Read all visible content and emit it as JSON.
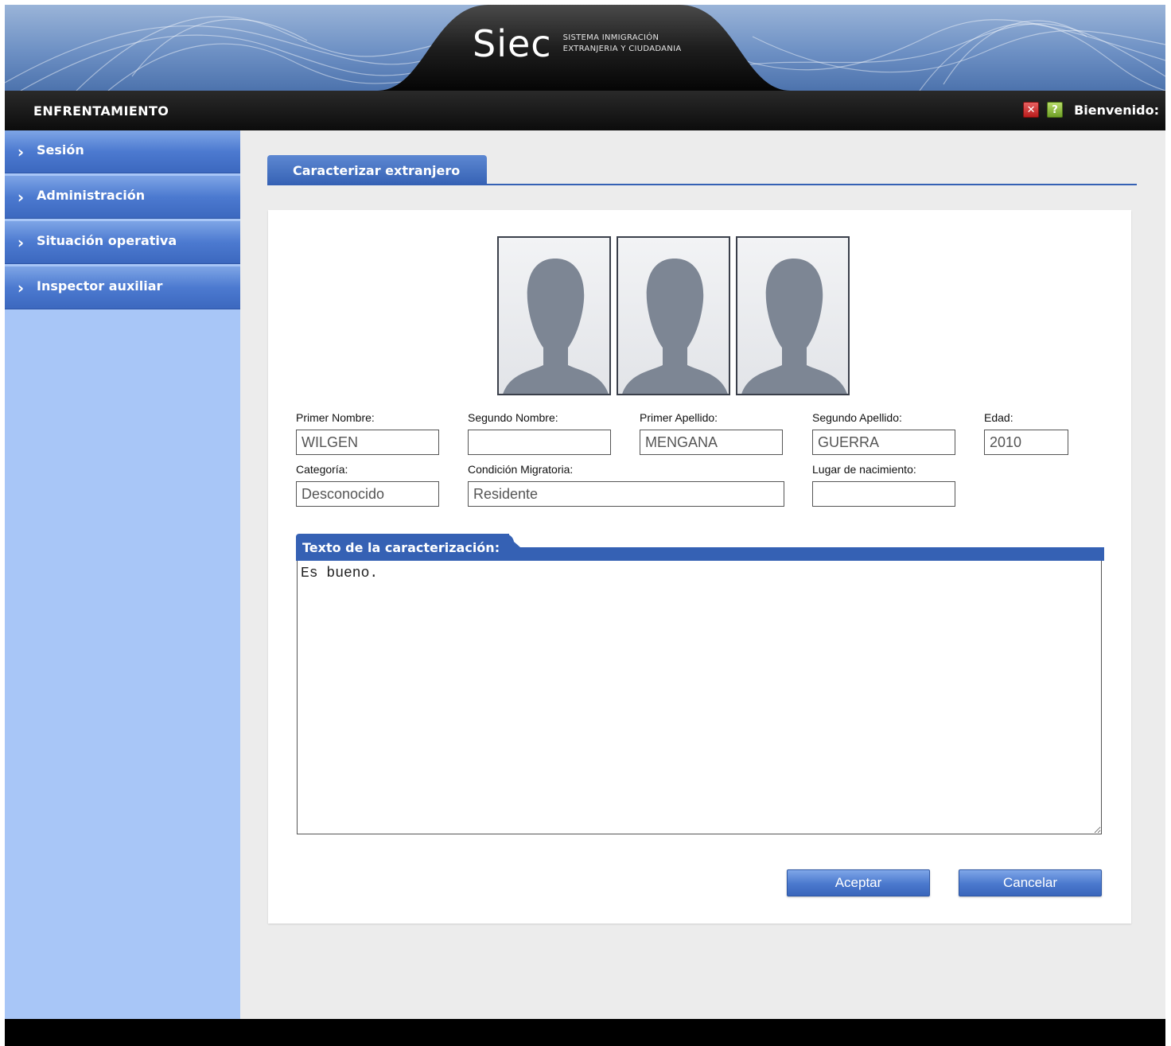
{
  "header": {
    "logo_text": "Siec",
    "logo_subtitle_line1": "SISTEMA INMIGRACIÓN",
    "logo_subtitle_line2": "EXTRANJERIA  Y CIUDADANIA",
    "section_title": "ENFRENTAMIENTO",
    "welcome": "Bienvenido:",
    "close_icon": "close-icon",
    "help_icon": "help-icon",
    "close_glyph": "✕",
    "help_glyph": "?"
  },
  "sidebar": {
    "items": [
      {
        "label": "Sesión",
        "icon": "chevron-right-icon"
      },
      {
        "label": "Administración",
        "icon": "chevron-right-icon"
      },
      {
        "label": "Situación operativa",
        "icon": "chevron-right-icon"
      },
      {
        "label": "Inspector auxiliar",
        "icon": "chevron-right-icon"
      }
    ]
  },
  "main": {
    "tab_label": "Caracterizar extranjero",
    "photos": [
      "person-placeholder-icon",
      "person-placeholder-icon",
      "person-placeholder-icon"
    ],
    "fields": {
      "primer_nombre": {
        "label": "Primer Nombre:",
        "value": "WILGEN"
      },
      "segundo_nombre": {
        "label": "Segundo Nombre:",
        "value": ""
      },
      "primer_apellido": {
        "label": "Primer Apellido:",
        "value": "MENGANA"
      },
      "segundo_apellido": {
        "label": "Segundo Apellido:",
        "value": "GUERRA"
      },
      "edad": {
        "label": "Edad:",
        "value": "2010"
      },
      "categoria": {
        "label": "Categoría:",
        "value": "Desconocido"
      },
      "condicion_migratoria": {
        "label": "Condición Migratoria:",
        "value": "Residente"
      },
      "lugar_nacimiento": {
        "label": "Lugar de nacimiento:",
        "value": ""
      }
    },
    "description": {
      "label": "Texto de la caracterización:",
      "value": "Es bueno."
    },
    "buttons": {
      "accept": "Aceptar",
      "cancel": "Cancelar"
    }
  },
  "colors": {
    "accent": "#3561b4",
    "sidebar_bg": "#a8c6f7",
    "content_bg": "#ececec",
    "titlebar_bg": "#0c0c0c"
  }
}
